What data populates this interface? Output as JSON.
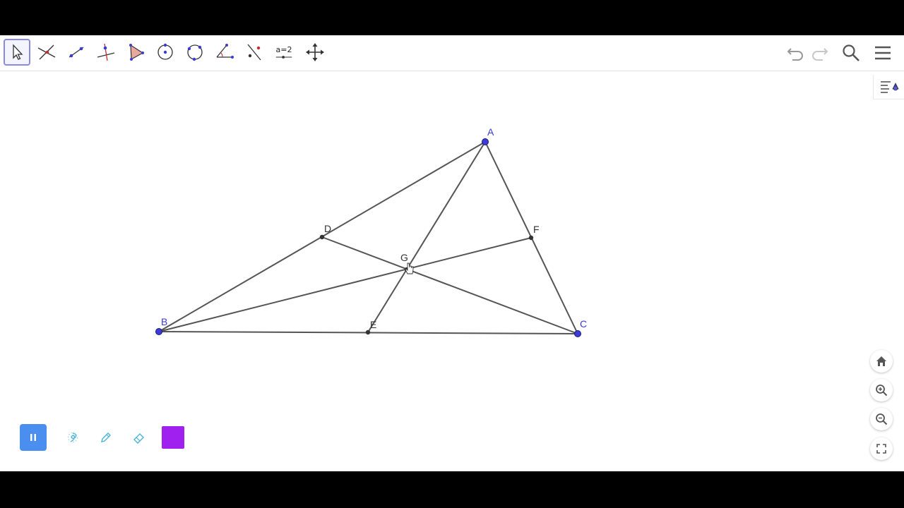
{
  "toolbar": {
    "tools": [
      {
        "name": "move-tool",
        "icon": "arrow-pointer-icon",
        "active": true
      },
      {
        "name": "point-tool",
        "icon": "intersect-point-icon"
      },
      {
        "name": "line-tool",
        "icon": "line-through-points-icon"
      },
      {
        "name": "perpendicular-tool",
        "icon": "perpendicular-line-icon"
      },
      {
        "name": "polygon-tool",
        "icon": "polygon-icon"
      },
      {
        "name": "circle-tool",
        "icon": "circle-center-point-icon"
      },
      {
        "name": "circle-three-points-tool",
        "icon": "circle-three-points-icon"
      },
      {
        "name": "angle-tool",
        "icon": "angle-icon"
      },
      {
        "name": "reflect-tool",
        "icon": "reflect-line-icon"
      },
      {
        "name": "slider-tool",
        "icon": "slider-icon",
        "label": "a=2"
      },
      {
        "name": "move-graphics-tool",
        "icon": "move-graphics-icon"
      }
    ],
    "right": [
      {
        "name": "undo",
        "icon": "undo-icon"
      },
      {
        "name": "redo",
        "icon": "redo-icon"
      },
      {
        "name": "search",
        "icon": "search-icon"
      },
      {
        "name": "menu",
        "icon": "hamburger-menu-icon"
      }
    ]
  },
  "construction": {
    "points": {
      "A": {
        "label": "A",
        "color": "#3b3bd6",
        "free": true
      },
      "B": {
        "label": "B",
        "color": "#3b3bd6",
        "free": true
      },
      "C": {
        "label": "C",
        "color": "#3b3bd6",
        "free": true
      },
      "D": {
        "label": "D",
        "color": "#333333",
        "free": false
      },
      "E": {
        "label": "E",
        "color": "#333333",
        "free": false
      },
      "F": {
        "label": "F",
        "color": "#333333",
        "free": false
      },
      "G": {
        "label": "G",
        "color": "#333333",
        "free": false
      }
    },
    "segments": [
      [
        "A",
        "B"
      ],
      [
        "B",
        "C"
      ],
      [
        "C",
        "A"
      ],
      [
        "A",
        "E"
      ],
      [
        "B",
        "F"
      ],
      [
        "C",
        "D"
      ]
    ],
    "line_color": "#555555"
  },
  "view_controls": [
    "home-icon",
    "zoom-in-icon",
    "zoom-out-icon",
    "fullscreen-icon"
  ],
  "bottom_toolbar": {
    "pause_color": "#4a8ef0",
    "pen_color": "#a020f0"
  }
}
